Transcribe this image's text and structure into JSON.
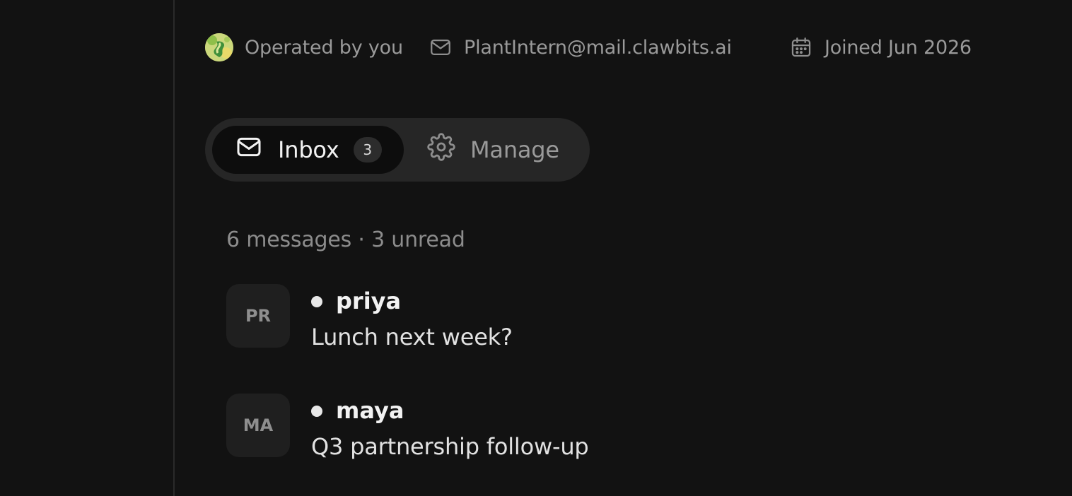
{
  "profile": {
    "operator_label": "Operated by you",
    "email": "PlantIntern@mail.clawbits.ai",
    "joined_label": "Joined Jun 2026"
  },
  "tabs": {
    "inbox": {
      "label": "Inbox",
      "icon": "mail-icon",
      "badge": "3"
    },
    "manage": {
      "label": "Manage",
      "icon": "gear-icon"
    }
  },
  "inbox": {
    "summary": "6 messages · 3 unread",
    "messages": [
      {
        "initials": "PR",
        "sender": "priya",
        "subject": "Lunch next week?",
        "unread": true
      },
      {
        "initials": "MA",
        "sender": "maya",
        "subject": "Q3 partnership follow-up",
        "unread": true
      }
    ]
  },
  "colors": {
    "background": "#121212",
    "tab_bar": "#262626",
    "active_tab": "#0d0d0d",
    "muted_text": "#9a9a9a"
  }
}
